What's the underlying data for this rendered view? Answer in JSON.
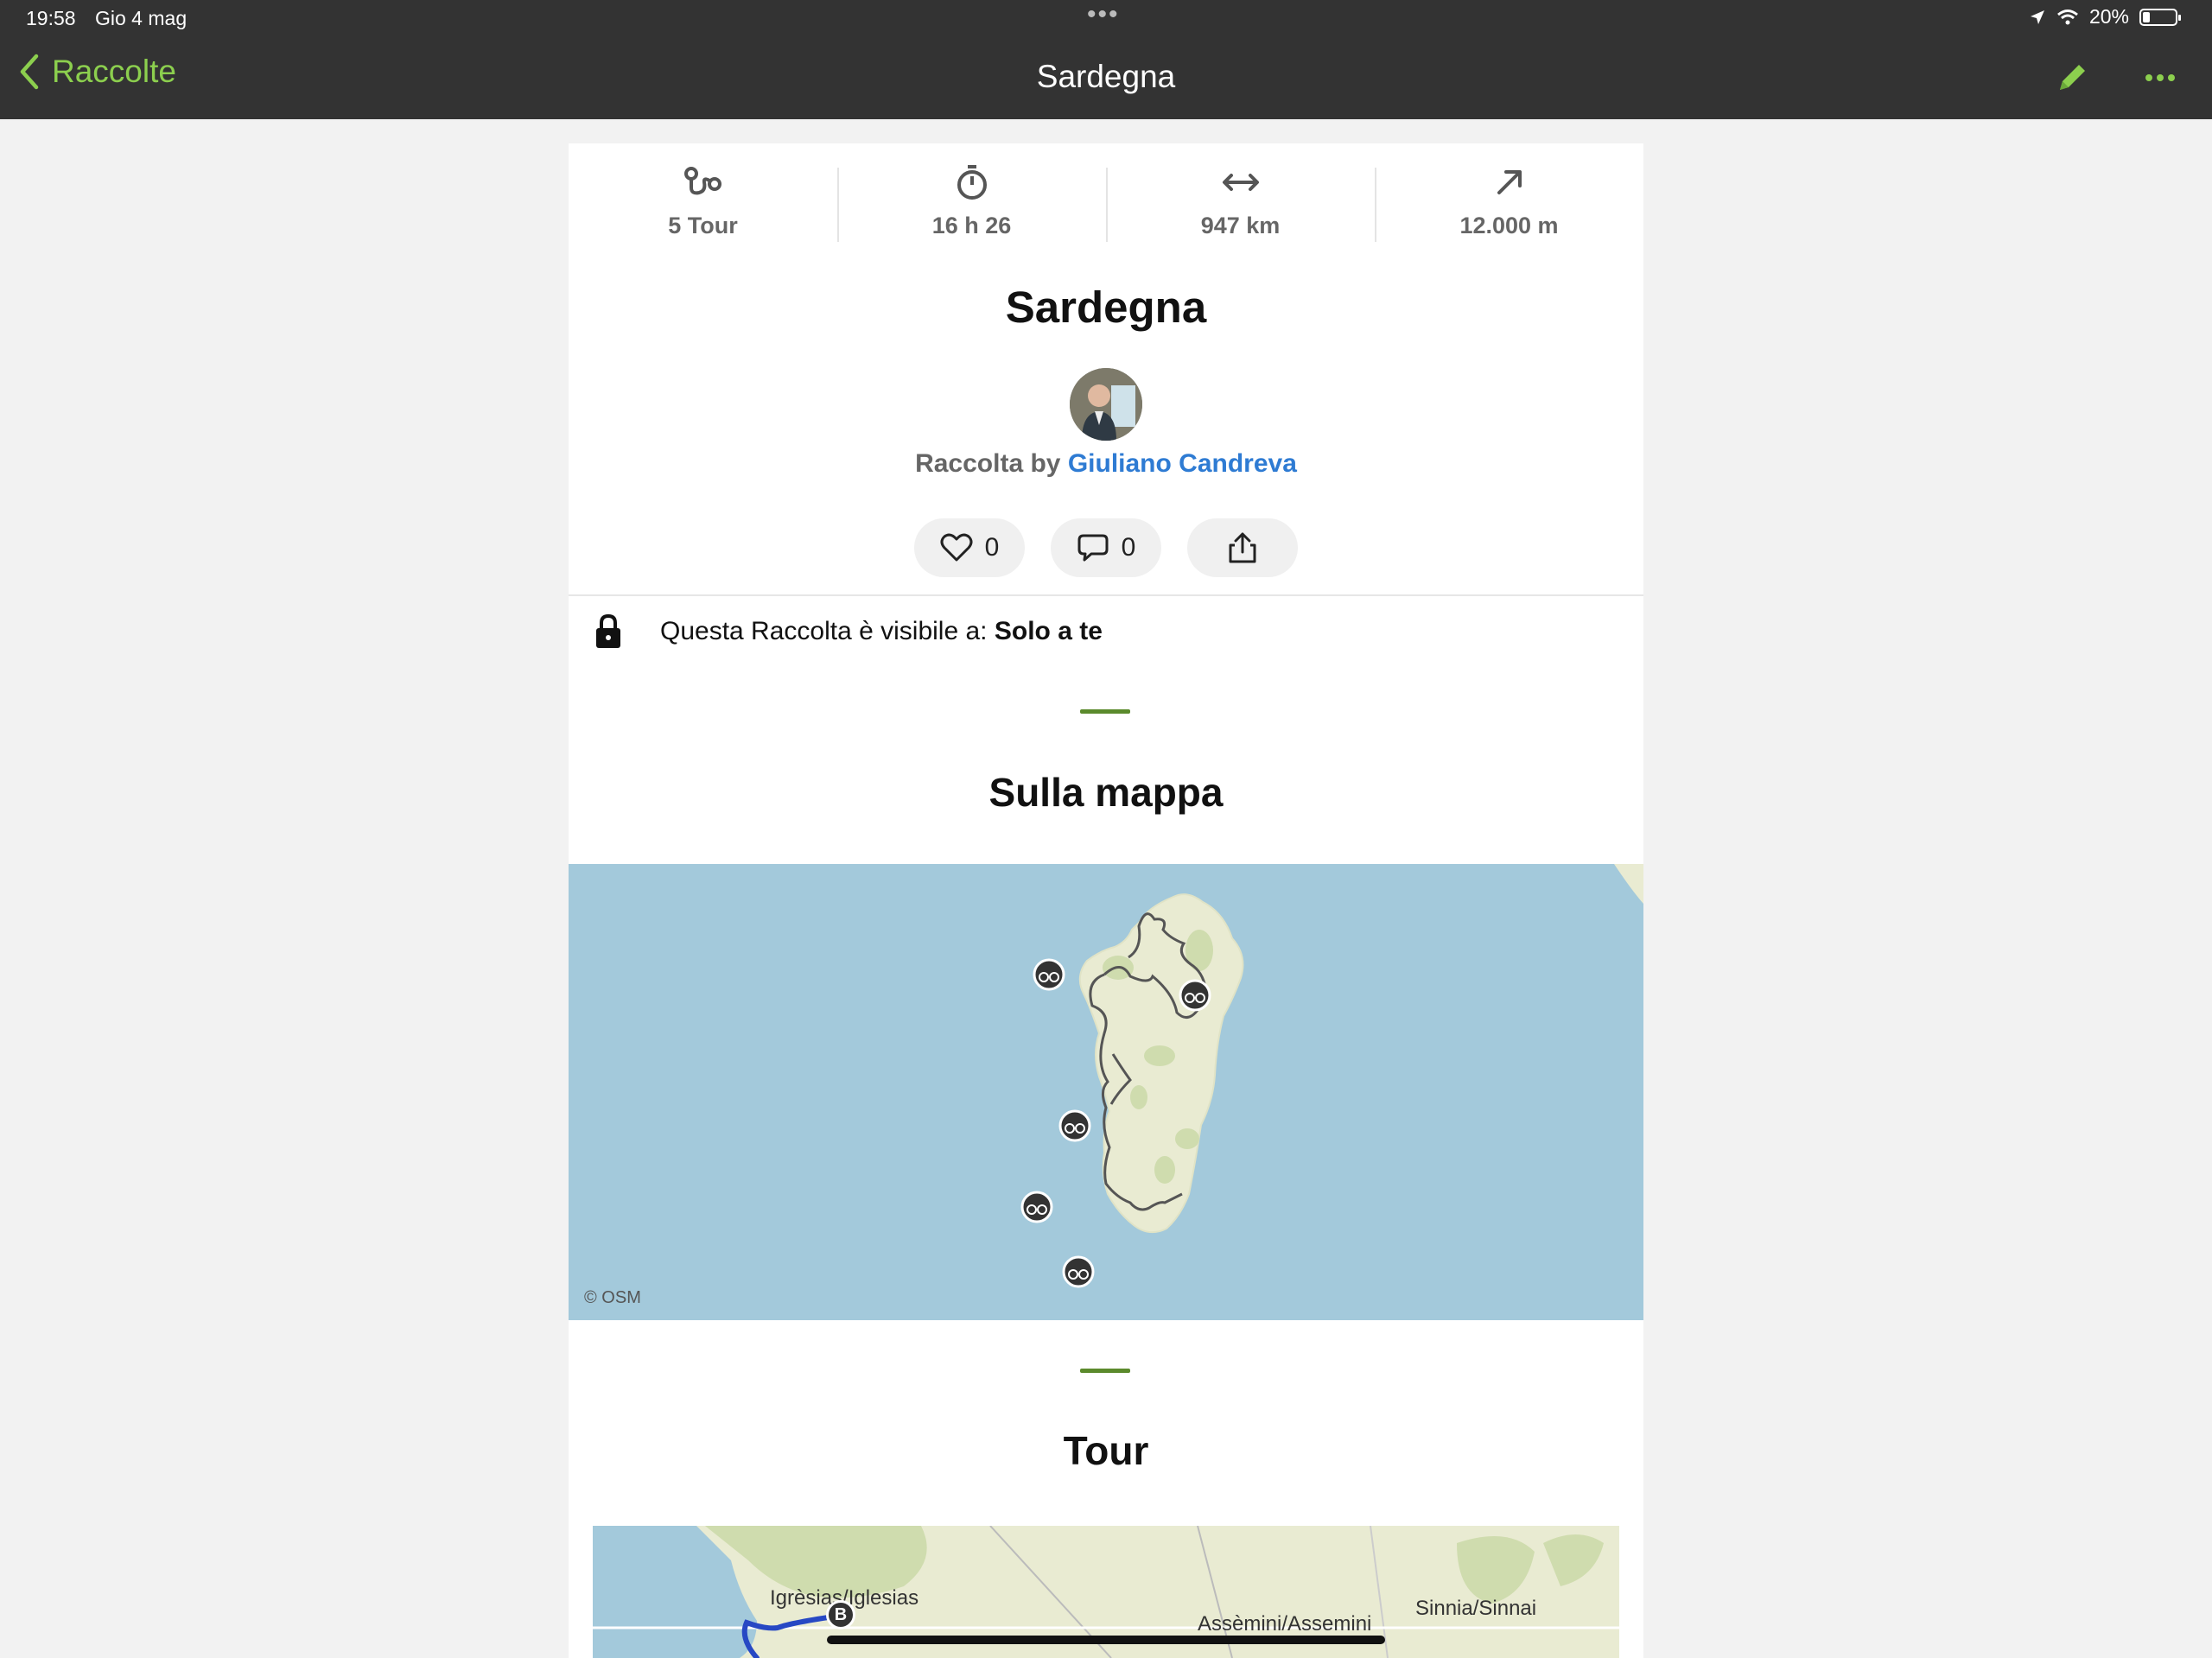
{
  "status": {
    "time": "19:58",
    "date": "Gio 4 mag",
    "battery": "20%"
  },
  "nav": {
    "back_label": "Raccolte",
    "title": "Sardegna"
  },
  "stats": [
    {
      "icon": "tour-icon",
      "value": "5 Tour"
    },
    {
      "icon": "stopwatch-icon",
      "value": "16 h 26"
    },
    {
      "icon": "distance-icon",
      "value": "947 km"
    },
    {
      "icon": "elevation-icon",
      "value": "12.000 m"
    }
  ],
  "collection": {
    "title": "Sardegna",
    "byline_prefix": "Raccolta by",
    "author": "Giuliano Candreva",
    "likes": "0",
    "comments": "0"
  },
  "visibility": {
    "text": "Questa Raccolta è visibile a:",
    "value": "Solo a te"
  },
  "sections": {
    "map_title": "Sulla mappa",
    "tours_title": "Tour"
  },
  "map": {
    "attribution": "© OSM"
  },
  "tour_map": {
    "places": [
      "Igrèsias/Iglesias",
      "Assèmini/Assemini",
      "Sinnia/Sinnai"
    ],
    "marker": "B"
  },
  "colors": {
    "accent": "#8ccf4e",
    "link": "#2e7bd3",
    "divider_accent": "#5b8a2c",
    "sea": "#a3c9db",
    "land": "#e9ebd2"
  }
}
